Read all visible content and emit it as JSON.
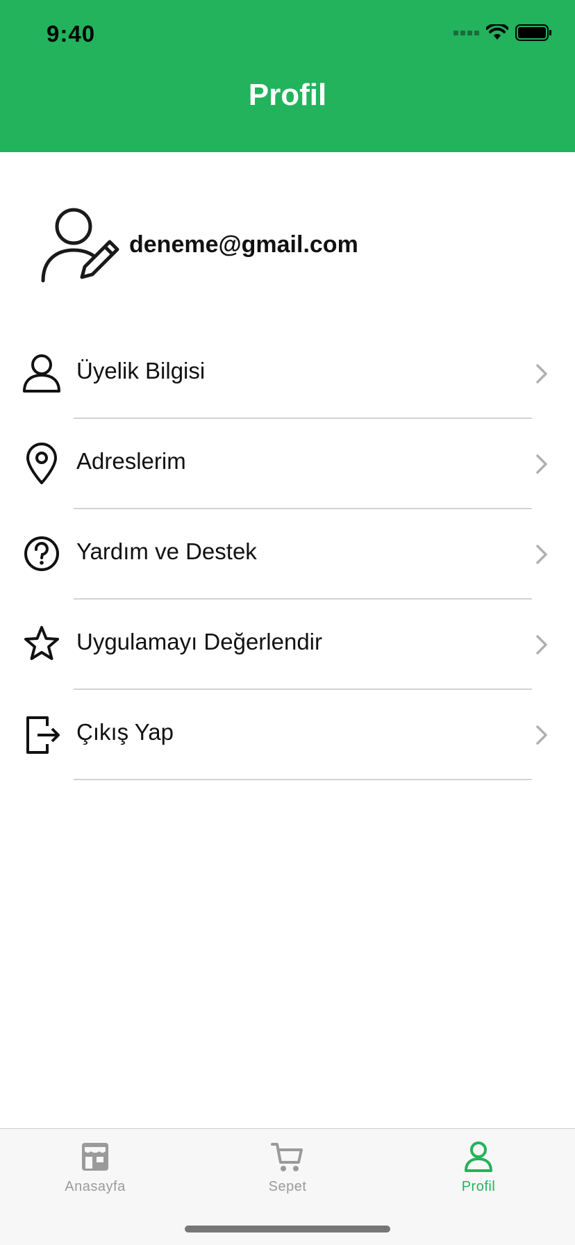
{
  "status_bar": {
    "time": "9:40"
  },
  "header": {
    "title": "Profil",
    "color": "#22b35c"
  },
  "profile": {
    "email": "deneme@gmail.com",
    "avatar_icon": "user-edit-icon"
  },
  "menu": [
    {
      "label": "Üyelik Bilgisi",
      "icon": "user-icon"
    },
    {
      "label": "Adreslerim",
      "icon": "location-pin-icon"
    },
    {
      "label": "Yardım ve Destek",
      "icon": "help-circle-icon"
    },
    {
      "label": "Uygulamayı Değerlendir",
      "icon": "star-icon"
    },
    {
      "label": "Çıkış Yap",
      "icon": "logout-icon"
    }
  ],
  "tabbar": {
    "tabs": [
      {
        "label": "Anasayfa",
        "icon": "store-icon",
        "active": false
      },
      {
        "label": "Sepet",
        "icon": "cart-icon",
        "active": false
      },
      {
        "label": "Profil",
        "icon": "user-icon",
        "active": true
      }
    ],
    "active_color": "#22b35c",
    "inactive_color": "#9a9a9a"
  }
}
